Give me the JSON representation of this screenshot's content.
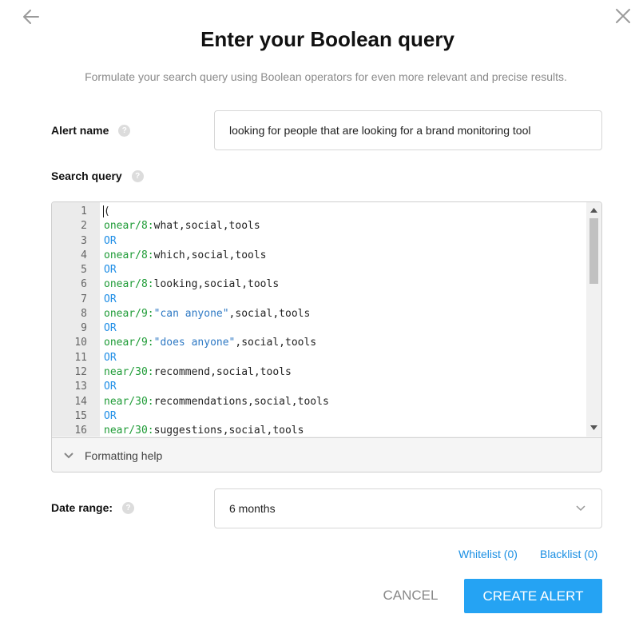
{
  "dialog": {
    "title": "Enter your Boolean query",
    "subtitle": "Formulate your search query using Boolean operators for even more relevant and precise results."
  },
  "alert_name": {
    "label": "Alert name",
    "value": "looking for people that are looking for a brand monitoring tool"
  },
  "search_query": {
    "label": "Search query",
    "lines": [
      {
        "n": "1",
        "parts": [
          {
            "t": "(",
            "c": "plain"
          }
        ]
      },
      {
        "n": "2",
        "parts": [
          {
            "t": "onear/8:",
            "c": "op"
          },
          {
            "t": "what,social,tools",
            "c": "plain"
          }
        ]
      },
      {
        "n": "3",
        "parts": [
          {
            "t": "OR",
            "c": "or"
          }
        ]
      },
      {
        "n": "4",
        "parts": [
          {
            "t": "onear/8:",
            "c": "op"
          },
          {
            "t": "which,social,tools",
            "c": "plain"
          }
        ]
      },
      {
        "n": "5",
        "parts": [
          {
            "t": "OR",
            "c": "or"
          }
        ]
      },
      {
        "n": "6",
        "parts": [
          {
            "t": "onear/8:",
            "c": "op"
          },
          {
            "t": "looking,social,tools",
            "c": "plain"
          }
        ]
      },
      {
        "n": "7",
        "parts": [
          {
            "t": "OR",
            "c": "or"
          }
        ]
      },
      {
        "n": "8",
        "parts": [
          {
            "t": "onear/9:",
            "c": "op"
          },
          {
            "t": "\"can anyone\"",
            "c": "str"
          },
          {
            "t": ",social,tools",
            "c": "plain"
          }
        ]
      },
      {
        "n": "9",
        "parts": [
          {
            "t": "OR",
            "c": "or"
          }
        ]
      },
      {
        "n": "10",
        "parts": [
          {
            "t": "onear/9:",
            "c": "op"
          },
          {
            "t": "\"does anyone\"",
            "c": "str"
          },
          {
            "t": ",social,tools",
            "c": "plain"
          }
        ]
      },
      {
        "n": "11",
        "parts": [
          {
            "t": "OR",
            "c": "or"
          }
        ]
      },
      {
        "n": "12",
        "parts": [
          {
            "t": "near/30:",
            "c": "op"
          },
          {
            "t": "recommend,social,tools",
            "c": "plain"
          }
        ]
      },
      {
        "n": "13",
        "parts": [
          {
            "t": "OR",
            "c": "or"
          }
        ]
      },
      {
        "n": "14",
        "parts": [
          {
            "t": "near/30:",
            "c": "op"
          },
          {
            "t": "recommendations,social,tools",
            "c": "plain"
          }
        ]
      },
      {
        "n": "15",
        "parts": [
          {
            "t": "OR",
            "c": "or"
          }
        ]
      },
      {
        "n": "16",
        "parts": [
          {
            "t": "near/30:",
            "c": "op"
          },
          {
            "t": "suggestions,social,tools",
            "c": "plain"
          }
        ]
      }
    ],
    "formatting_help": "Formatting help"
  },
  "date_range": {
    "label": "Date range:",
    "value": "6 months"
  },
  "links": {
    "whitelist": "Whitelist (0)",
    "blacklist": "Blacklist (0)"
  },
  "actions": {
    "cancel": "CANCEL",
    "create": "CREATE ALERT"
  },
  "colors": {
    "accent": "#25a3f3",
    "operator": "#1e9b36",
    "or_keyword": "#1f8ee6",
    "string": "#2e79c4"
  },
  "icons": {
    "back": "arrow-left-icon",
    "close": "close-icon",
    "help": "question-circle-icon",
    "expand": "chevron-down-icon"
  }
}
